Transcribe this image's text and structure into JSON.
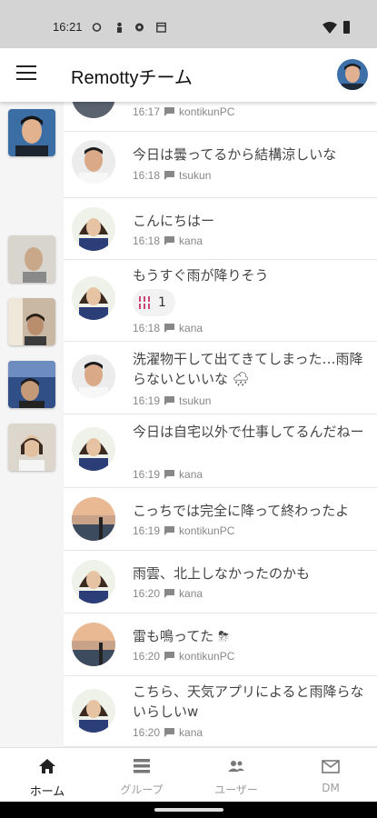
{
  "status_bar": {
    "time": "16:21"
  },
  "app_bar": {
    "title": "Remottyチーム"
  },
  "timeline": {
    "messages": [
      {
        "text": "",
        "time": "16:17",
        "user": "kontikunPC"
      },
      {
        "text": "今日は曇ってるから結構涼しいな",
        "time": "16:18",
        "user": "tsukun"
      },
      {
        "text": "こんにちはー",
        "time": "16:18",
        "user": "kana"
      },
      {
        "text": "もうすぐ雨が降りそう",
        "time": "16:18",
        "user": "kana",
        "reaction_count": "1"
      },
      {
        "text": "洗濯物干して出てきてしまった…雨降らないといいな 🌧",
        "time": "16:19",
        "user": "tsukun"
      },
      {
        "text": "今日は自宅以外で仕事してるんだねー",
        "time": "16:19",
        "user": "kana"
      },
      {
        "text": "こっちでは完全に降って終わったよ",
        "time": "16:19",
        "user": "kontikunPC"
      },
      {
        "text": "雨雲、北上しなかったのかも",
        "time": "16:20",
        "user": "kana"
      },
      {
        "text": "雷も鳴ってた ⛈",
        "time": "16:20",
        "user": "kontikunPC"
      },
      {
        "text": "こちら、天気アプリによると雨降らないらしいw",
        "time": "16:20",
        "user": "kana"
      }
    ]
  },
  "bottom_nav": {
    "home": "ホーム",
    "groups": "グループ",
    "users": "ユーザー",
    "dm": "DM"
  },
  "colors": {
    "accent": "#222222",
    "inactive": "#9e9e9e",
    "reaction": "#c2185b"
  }
}
